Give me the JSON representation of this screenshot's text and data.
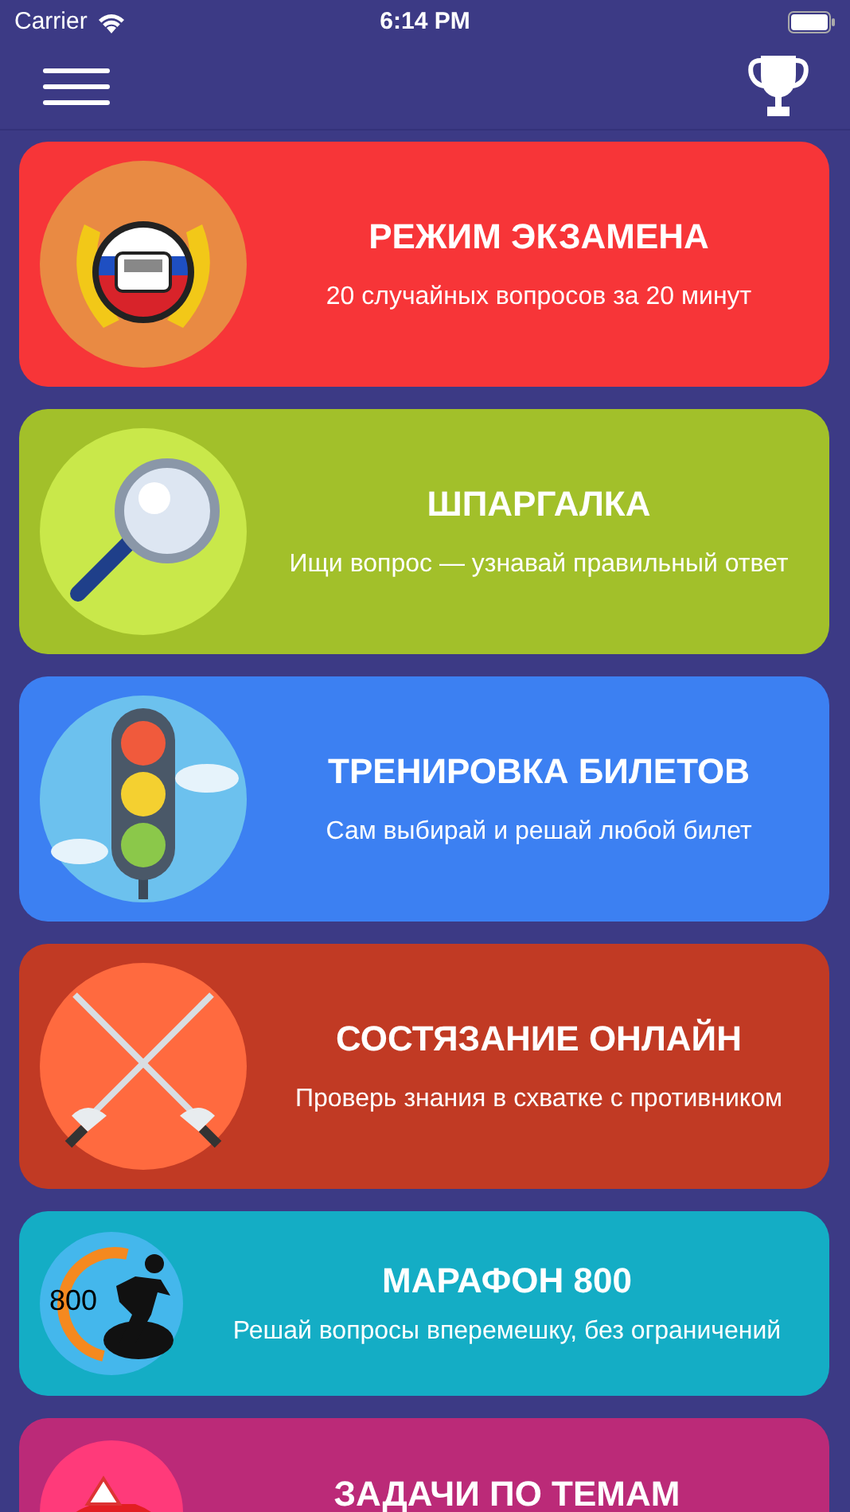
{
  "status_bar": {
    "carrier": "Carrier",
    "time": "6:14 PM"
  },
  "modes": [
    {
      "kind": "emblem",
      "title": "РЕЖИМ ЭКЗАМЕНА",
      "subtitle": "20 случайных вопросов за 20 минут",
      "color": "#f73538"
    },
    {
      "kind": "magnifier",
      "title": "ШПАРГАЛКА",
      "subtitle": "Ищи вопрос — узнавай правильный ответ",
      "color": "#a2c02a"
    },
    {
      "kind": "traffic-light",
      "title": "ТРЕНИРОВКА БИЛЕТОВ",
      "subtitle": "Сам выбирай и решай любой билет",
      "color": "#3c80f2"
    },
    {
      "kind": "swords",
      "title": "СОСТЯЗАНИЕ ОНЛАЙН",
      "subtitle": "Проверь знания в схватке с противником",
      "color": "#c13a24"
    },
    {
      "kind": "runner",
      "title": "МАРАФОН 800",
      "subtitle": "Решай вопросы вперемешку, без ограничений",
      "color": "#14adc5",
      "icon_text": "800"
    },
    {
      "kind": "car",
      "title": "ЗАДАЧИ ПО ТЕМАМ",
      "color": "#bb2a78"
    }
  ]
}
